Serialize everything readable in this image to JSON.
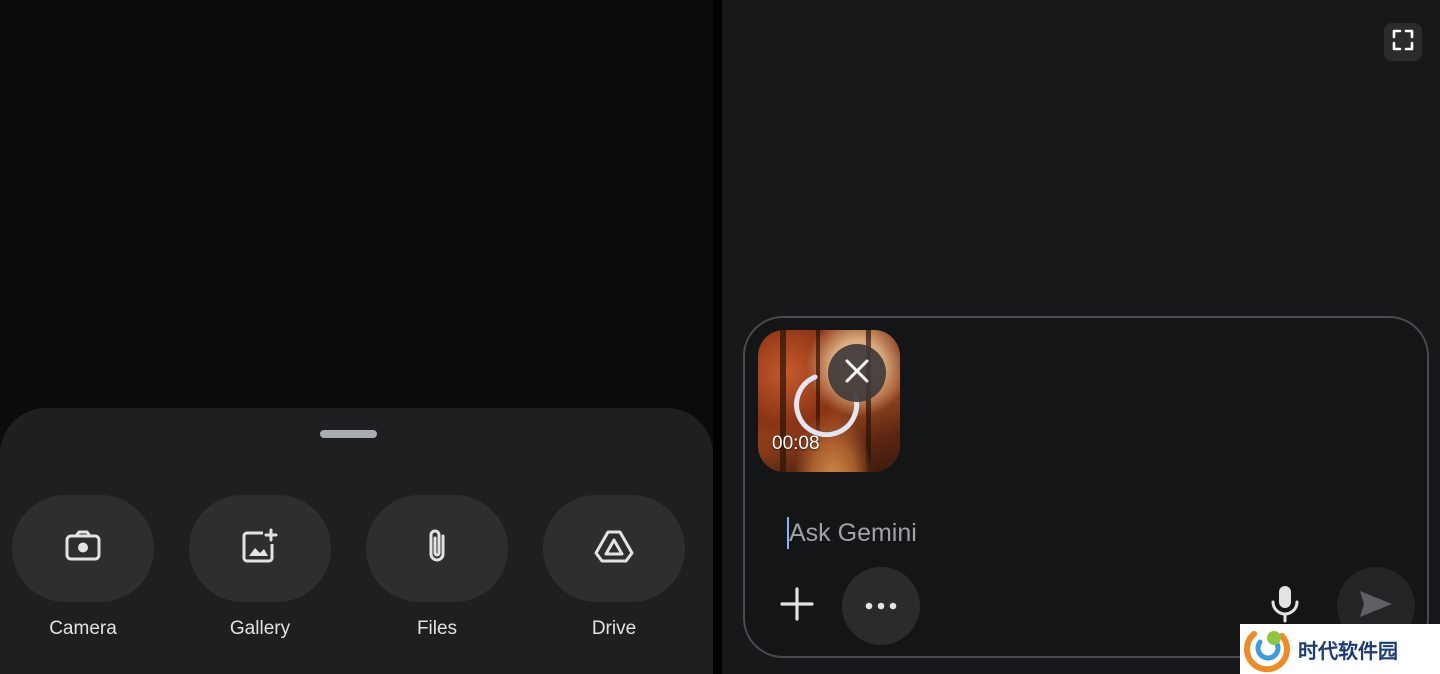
{
  "left_panel": {
    "attach_options": [
      {
        "label": "Camera",
        "icon": "camera-icon"
      },
      {
        "label": "Gallery",
        "icon": "gallery-add-icon"
      },
      {
        "label": "Files",
        "icon": "paperclip-icon"
      },
      {
        "label": "Drive",
        "icon": "drive-icon"
      }
    ]
  },
  "right_panel": {
    "attachment": {
      "duration": "00:08",
      "upload_state": "uploading"
    },
    "input": {
      "placeholder": "Ask Gemini",
      "value": ""
    },
    "icons": {
      "fullscreen": "fullscreen-icon",
      "add": "plus-icon",
      "more": "more-horiz-icon",
      "mic": "microphone-icon",
      "send": "send-icon"
    }
  },
  "watermark": {
    "text": "时代软件园"
  },
  "colors": {
    "sheet_bg": "#1e1f20",
    "button_bg": "#2d2e30",
    "panel_bg": "#17181a",
    "caret": "#8ab4f8",
    "watermark_text": "#1b3b78"
  }
}
